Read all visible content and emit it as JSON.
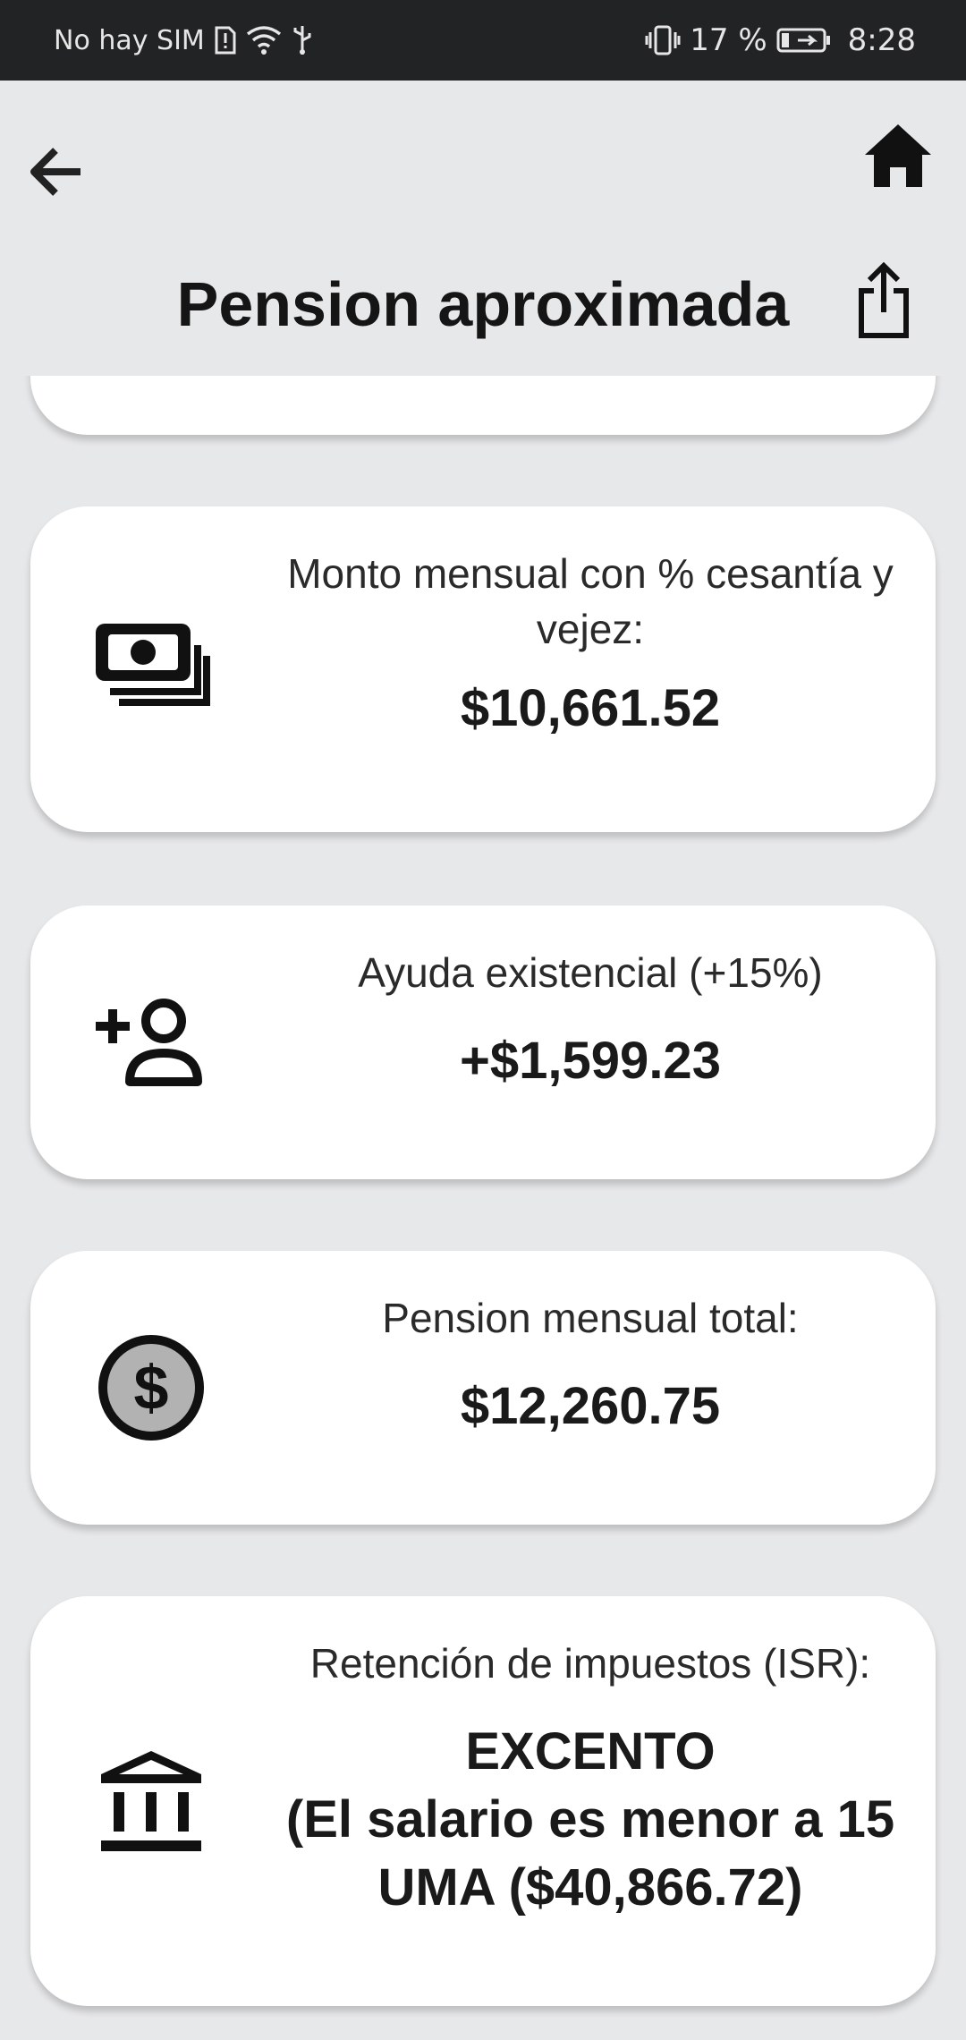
{
  "status_bar": {
    "carrier": "No hay SIM",
    "battery_pct": "17 %",
    "time": "8:28",
    "icons": [
      "sim-alert-icon",
      "wifi-icon",
      "usb-icon",
      "vibrate-icon",
      "battery-charging-icon"
    ]
  },
  "app_bar": {
    "title": "Pension aproximada",
    "icons": [
      "back-arrow-icon",
      "home-icon",
      "share-icon"
    ]
  },
  "cards": {
    "monthly": {
      "label": "Monto mensual con % cesantía y vejez:",
      "value": "$10,661.52",
      "icon": "money-bills-icon"
    },
    "aid": {
      "label": "Ayuda existencial (+15%)",
      "value": "+$1,599.23",
      "icon": "person-add-icon"
    },
    "total": {
      "label": "Pension mensual total:",
      "value": "$12,260.75",
      "icon": "dollar-circle-icon"
    },
    "tax": {
      "label": "Retención de impuestos (ISR):",
      "value": "EXCENTO\n(El salario es menor a 15 UMA ($40,866.72)",
      "icon": "bank-icon"
    }
  },
  "colors": {
    "background": "#e7e8ea",
    "card": "#ffffff",
    "status_bar": "#222325",
    "text": "#1a1a1a"
  }
}
